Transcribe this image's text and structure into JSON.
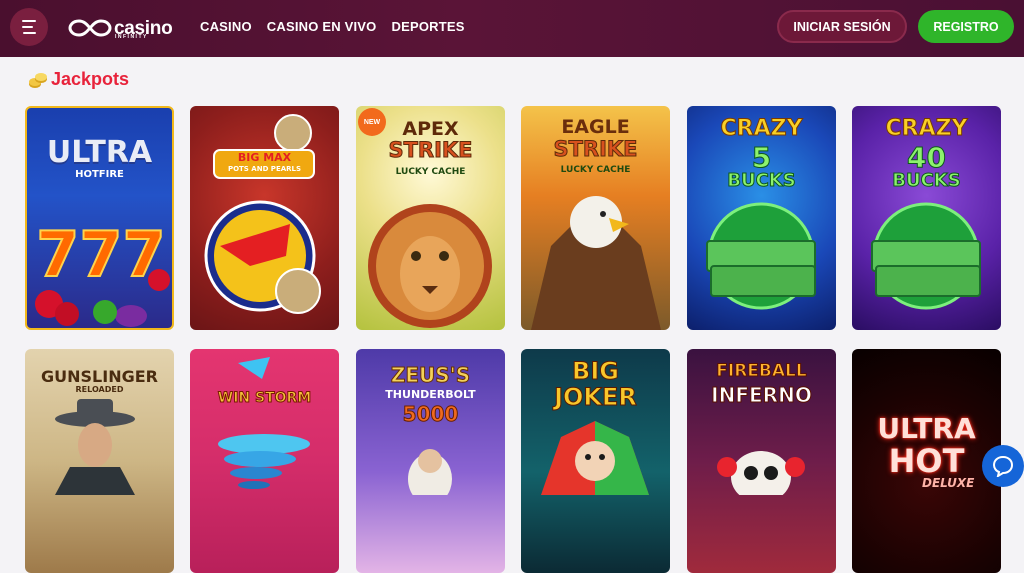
{
  "header": {
    "logo_text": "casino",
    "logo_sub": "INFINITY",
    "nav": [
      "CASINO",
      "CASINO EN VIVO",
      "DEPORTES"
    ],
    "login_label": "INICIAR SESIÓN",
    "register_label": "REGISTRO"
  },
  "section": {
    "title": "Jackpots"
  },
  "games": [
    {
      "name": "Ultra Hotfire",
      "title_line1": "ULTRA",
      "title_line2": "HOTFIRE",
      "art": "777"
    },
    {
      "name": "Big Max Pots and Pearls",
      "title_line1": "BIG MAX",
      "title_line2": "POTS AND PEARLS"
    },
    {
      "name": "Apex Strike Lucky Cache",
      "badge": "NEW",
      "title_line1": "APEX",
      "title_line2": "STRIKE",
      "title_line3": "LUCKY CACHE"
    },
    {
      "name": "Eagle Strike Lucky Cache",
      "title_line1": "EAGLE",
      "title_line2": "STRIKE",
      "title_line3": "LUCKY CACHE"
    },
    {
      "name": "Crazy 5 Bucks",
      "title_line1": "CRAZY",
      "title_line2": "5",
      "title_line3": "BUCKS"
    },
    {
      "name": "Crazy 40 Bucks",
      "title_line1": "CRAZY",
      "title_line2": "40",
      "title_line3": "BUCKS"
    },
    {
      "name": "Gunslinger Reloaded",
      "title_line1": "GUNSLINGER",
      "title_line2": "RELOADED"
    },
    {
      "name": "Win Storm",
      "title_line1": "WIN STORM"
    },
    {
      "name": "Zeus's Thunderbolt 5000",
      "title_line1": "ZEUS'S",
      "title_line2": "THUNDERBOLT",
      "title_line3": "5000"
    },
    {
      "name": "Big Joker",
      "title_line1": "BIG",
      "title_line2": "JOKER"
    },
    {
      "name": "Fireball Inferno",
      "title_line1": "FIREBALL",
      "title_line2": "INFERNO"
    },
    {
      "name": "Ultra Hot Deluxe",
      "title_line1": "ULTRA",
      "title_line2": "HOT",
      "title_line3": "DELUXE"
    }
  ],
  "colors": {
    "header_bg": "#4f1232",
    "accent_red": "#e8233b",
    "register_green": "#2fb52a",
    "chat_blue": "#1565d8"
  }
}
